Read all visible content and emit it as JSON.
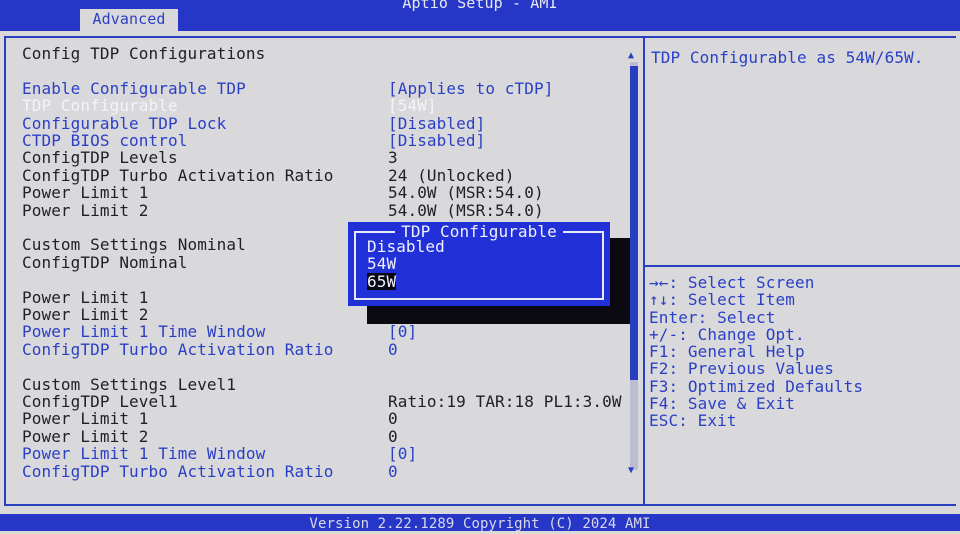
{
  "header": {
    "title": "Aptio Setup - AMI",
    "tab": "Advanced"
  },
  "main": {
    "rows": [
      {
        "label": "Config TDP Configurations",
        "value": "",
        "style": "black"
      },
      {
        "label": "",
        "value": "",
        "style": "black"
      },
      {
        "label": "Enable Configurable TDP",
        "value": "[Applies to cTDP]",
        "style": "blue"
      },
      {
        "label": "TDP Configurable",
        "value": "[54W]",
        "style": "white"
      },
      {
        "label": "Configurable TDP Lock",
        "value": "[Disabled]",
        "style": "blue"
      },
      {
        "label": "CTDP BIOS control",
        "value": "[Disabled]",
        "style": "blue"
      },
      {
        "label": "ConfigTDP Levels",
        "value": "3",
        "style": "black"
      },
      {
        "label": "ConfigTDP Turbo Activation Ratio",
        "value": "24 (Unlocked)",
        "style": "black"
      },
      {
        "label": "Power Limit 1",
        "value": "54.0W (MSR:54.0)",
        "style": "black"
      },
      {
        "label": "Power Limit 2",
        "value": "54.0W (MSR:54.0)",
        "style": "black"
      },
      {
        "label": "",
        "value": "",
        "style": "black"
      },
      {
        "label": "Custom Settings Nominal",
        "value": "",
        "style": "black"
      },
      {
        "label": "ConfigTDP Nominal",
        "value": "",
        "style": "black"
      },
      {
        "label": "",
        "value": "",
        "style": "black"
      },
      {
        "label": "Power Limit 1",
        "value": "",
        "style": "black"
      },
      {
        "label": "Power Limit 2",
        "value": "",
        "style": "black"
      },
      {
        "label": "Power Limit 1 Time Window",
        "value": "[0]",
        "style": "blue"
      },
      {
        "label": "ConfigTDP Turbo Activation Ratio",
        "value": "0",
        "style": "blue"
      },
      {
        "label": "",
        "value": "",
        "style": "black"
      },
      {
        "label": "Custom Settings Level1",
        "value": "",
        "style": "black"
      },
      {
        "label": "ConfigTDP Level1",
        "value": "Ratio:19 TAR:18 PL1:3.0W",
        "style": "black"
      },
      {
        "label": "Power Limit 1",
        "value": "0",
        "style": "black"
      },
      {
        "label": "Power Limit 2",
        "value": "0",
        "style": "black"
      },
      {
        "label": "Power Limit 1 Time Window",
        "value": "[0]",
        "style": "blue"
      },
      {
        "label": "ConfigTDP Turbo Activation Ratio",
        "value": "0",
        "style": "blue"
      }
    ]
  },
  "popup": {
    "title": "TDP Configurable",
    "options": [
      "Disabled",
      "54W",
      "65W"
    ],
    "selected": "65W"
  },
  "help": {
    "text": "TDP Configurable as 54W/65W."
  },
  "keys": [
    "→←: Select Screen",
    "↑↓: Select Item",
    "Enter: Select",
    "+/-: Change Opt.",
    "F1: General Help",
    "F2: Previous Values",
    "F3: Optimized Defaults",
    "F4: Save & Exit",
    "ESC: Exit"
  ],
  "footer": {
    "version": "Version 2.22.1289 Copyright (C) 2024 AMI"
  },
  "colors": {
    "accent": "#2637c8",
    "background": "#d9d9dc",
    "highlight": "#f4f4f8"
  }
}
